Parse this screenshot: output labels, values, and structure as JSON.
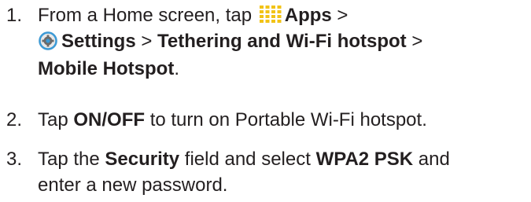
{
  "steps": [
    {
      "number": "1.",
      "lines": [
        {
          "pre": "From a Home screen, tap ",
          "icon": "apps-grid-icon",
          "bold": "Apps",
          "post": " >"
        },
        {
          "icon": "settings-gear-icon",
          "bold1": "Settings",
          "mid": " > ",
          "bold2": "Tethering and Wi-Fi hotspot",
          "post": " >"
        },
        {
          "bold": "Mobile Hotspot",
          "post": "."
        }
      ]
    },
    {
      "number": "2.",
      "lines": [
        {
          "pre": "Tap ",
          "bold": "ON/OFF",
          "post": " to turn on Portable Wi-Fi hotspot."
        }
      ]
    },
    {
      "number": "3.",
      "lines": [
        {
          "pre": "Tap the ",
          "bold1": "Security",
          "mid": " field and select ",
          "bold2": "WPA2 PSK",
          "post": " and"
        },
        {
          "text": "enter a new password."
        }
      ]
    }
  ],
  "colors": {
    "text": "#231f20",
    "apps_icon": "#f2c316",
    "settings_icon_ring": "#3b9ad6"
  }
}
